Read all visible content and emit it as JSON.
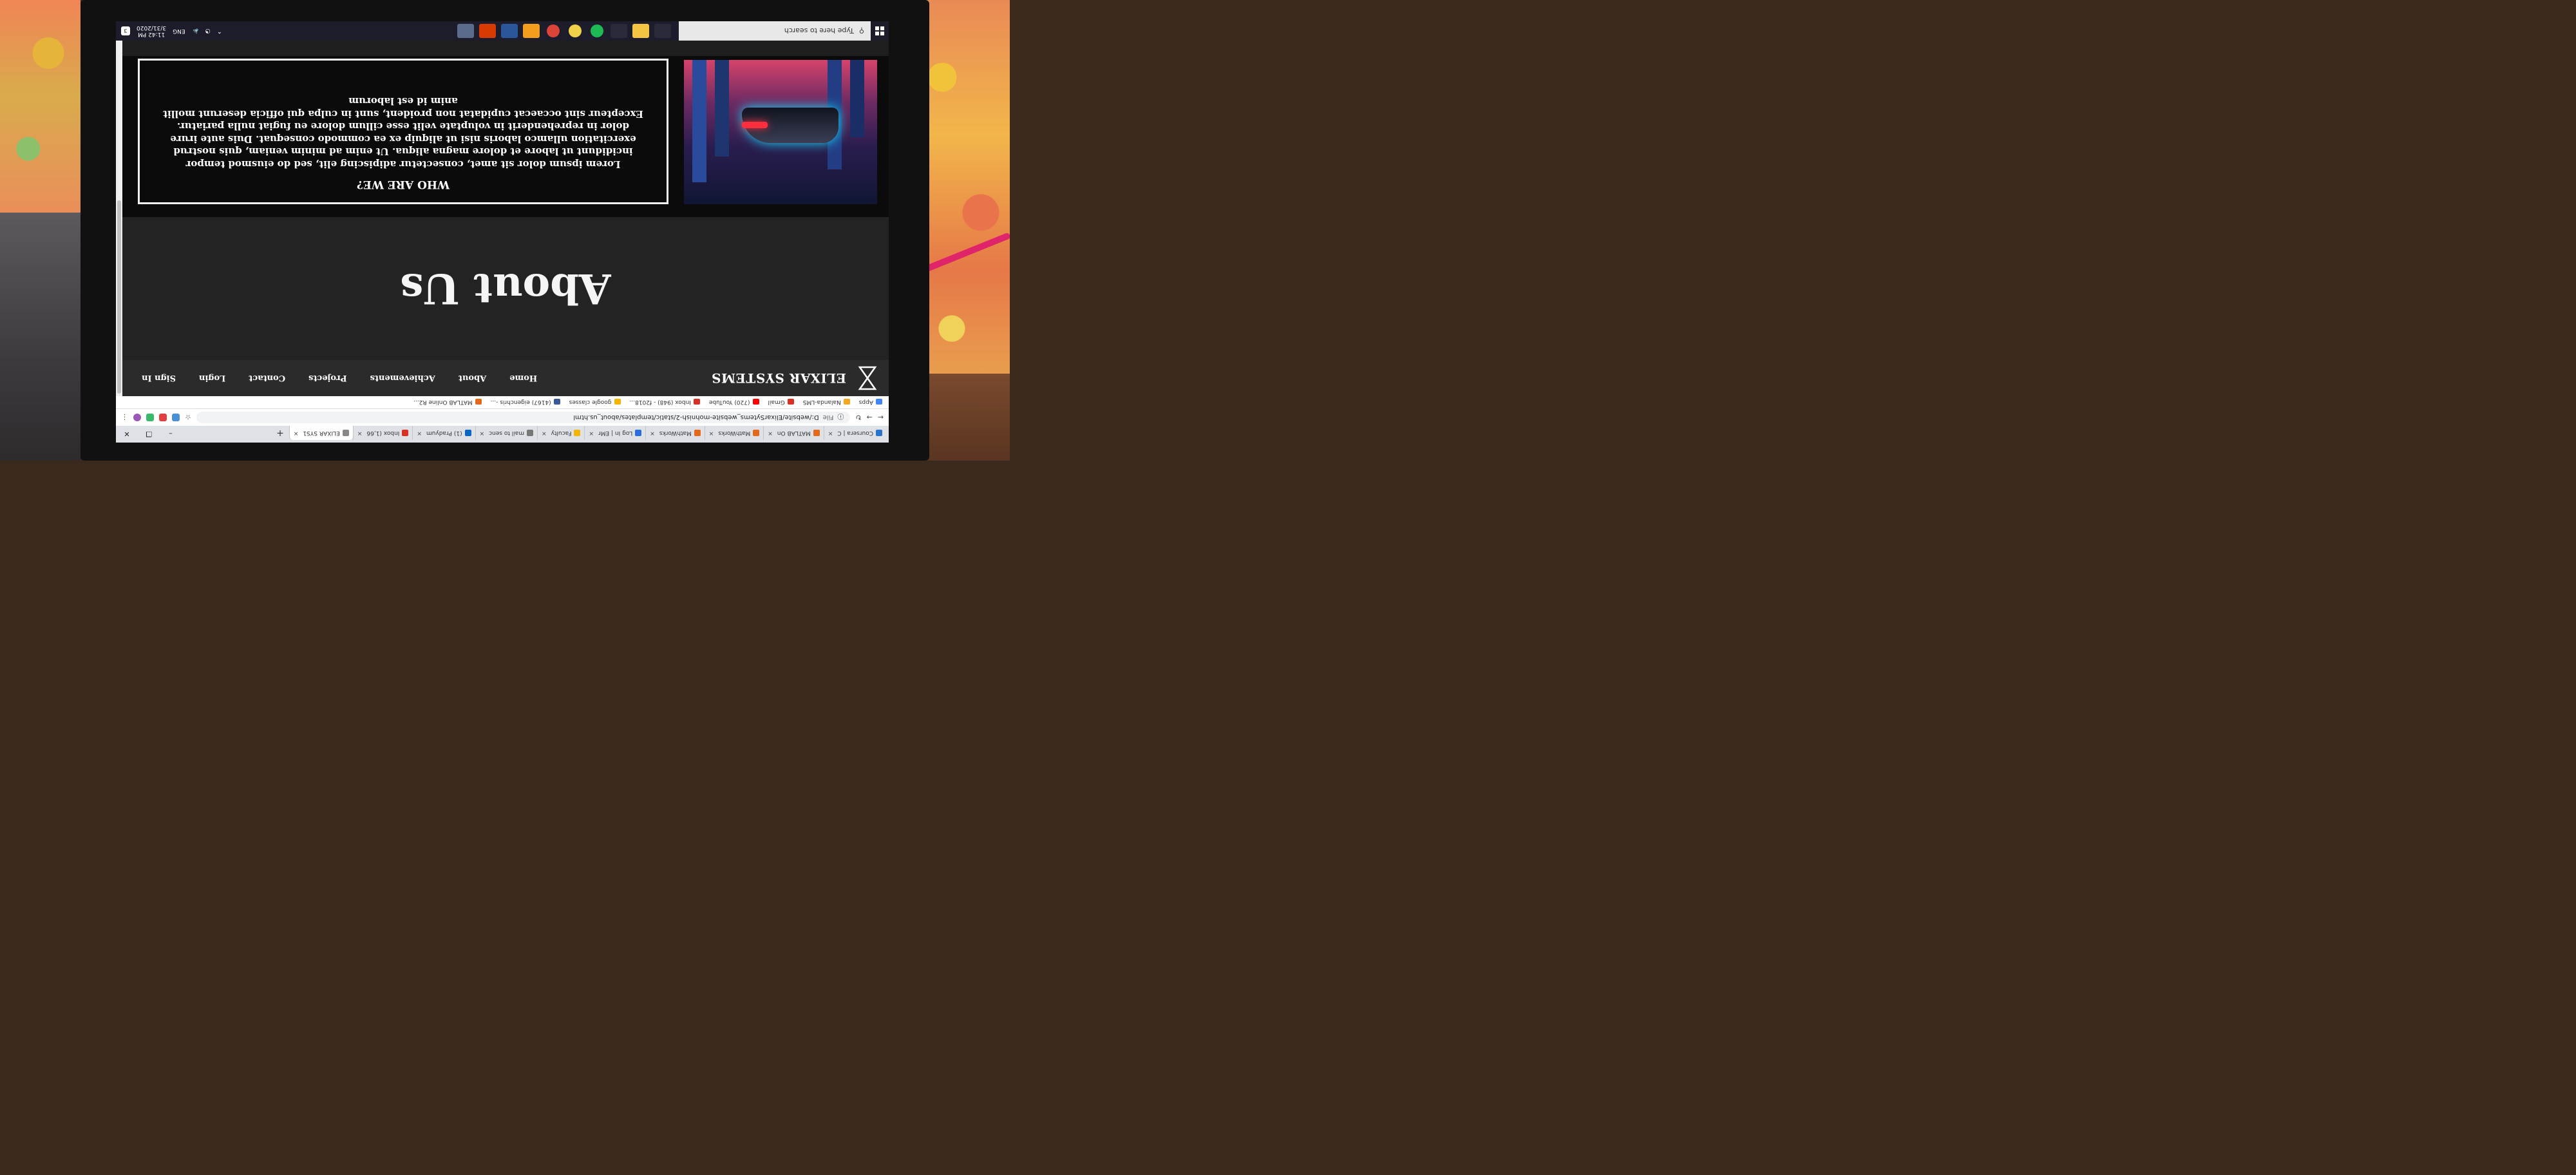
{
  "browser": {
    "tabs": [
      {
        "label": "Coursera | C",
        "color": "#2a73cc"
      },
      {
        "label": "MATLAB On",
        "color": "#e26a1a"
      },
      {
        "label": "MathWorks",
        "color": "#e26a1a"
      },
      {
        "label": "MathWorks",
        "color": "#e26a1a"
      },
      {
        "label": "Log In | EMr",
        "color": "#2b6de0"
      },
      {
        "label": "Faculty",
        "color": "#f4b400"
      },
      {
        "label": "mail to senc",
        "color": "#777777"
      },
      {
        "label": "(1) Pradyum",
        "color": "#0a66c2"
      },
      {
        "label": "Inbox (1,66",
        "color": "#d93025"
      },
      {
        "label": "ELIXAR SYS1",
        "color": "#888888"
      }
    ],
    "new_tab_symbol": "+",
    "window_controls": {
      "minimize": "–",
      "restore": "❐",
      "close": "✕"
    },
    "tab_close_symbol": "✕",
    "address": {
      "file_label": "File",
      "url": "D:/website/ElixarSytems_website-mohnish-2/static/templates/about_us.html"
    },
    "bookmarks": [
      {
        "label": "Apps",
        "color": "#4285f4"
      },
      {
        "label": "Nalanda-LMS",
        "color": "#f5a623"
      },
      {
        "label": "Gmail",
        "color": "#d93025"
      },
      {
        "label": "(720) YouTube",
        "color": "#ff0000"
      },
      {
        "label": "Inbox (948) - f2018...",
        "color": "#d93025"
      },
      {
        "label": "google classes",
        "color": "#f4b400"
      },
      {
        "label": "(4167) eigenchris -...",
        "color": "#3b5998"
      },
      {
        "label": "MATLAB Online R2...",
        "color": "#e26a1a"
      }
    ]
  },
  "site": {
    "brand": "ELIXAR SYSTEMS",
    "nav": [
      "Home",
      "About",
      "Achievements",
      "Projects",
      "Contact",
      "Login",
      "Sign In"
    ],
    "hero_title": "About Us",
    "about_heading": "WHO ARE WE?",
    "about_text": "Lorem ipsum dolor sit amet, consectetur adipiscing elit, sed do eiusmod tempor incididunt ut labore et dolore magna aliqua. Ut enim ad minim veniam, quis nostrud exercitation ullamco laboris nisi ut aliquip ex ea commodo consequat. Duis aute irure dolor in reprehenderit in voluptate velit esse cillum dolore eu fugiat nulla pariatur. Excepteur sint occaecat cupidatat non proident, sunt in culpa qui officia deserunt mollit anim id est laborum"
  },
  "taskbar": {
    "search_placeholder": "Type here to search",
    "apps": [
      {
        "name": "task-view",
        "color": "#2a2a3a"
      },
      {
        "name": "file-explorer",
        "color": "#f4c542"
      },
      {
        "name": "store",
        "color": "#2a2a3a"
      },
      {
        "name": "spotify",
        "color": "#1db954"
      },
      {
        "name": "app-yellow",
        "color": "#f0d24a"
      },
      {
        "name": "chrome",
        "color": "#db4437"
      },
      {
        "name": "sublime",
        "color": "#f29d1d"
      },
      {
        "name": "word",
        "color": "#2b579a"
      },
      {
        "name": "office",
        "color": "#d83b01"
      },
      {
        "name": "paint",
        "color": "#5a6b8c"
      }
    ],
    "language": "ENG",
    "time": "11:42 PM",
    "date": "3/31/2020",
    "notification_count": "3"
  }
}
